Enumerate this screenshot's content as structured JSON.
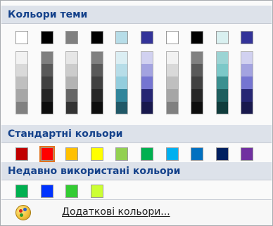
{
  "theme_colors": {
    "header": "Кольори теми",
    "columns": [
      {
        "name": "white",
        "shades": [
          "#ffffff",
          "#f2f2f2",
          "#d9d9d9",
          "#bfbfbf",
          "#a6a6a6",
          "#808080"
        ]
      },
      {
        "name": "black",
        "shades": [
          "#000000",
          "#7f7f7f",
          "#595959",
          "#404040",
          "#262626",
          "#0d0d0d"
        ]
      },
      {
        "name": "gray",
        "shades": [
          "#808080",
          "#e6e6e6",
          "#cccccc",
          "#b3b3b3",
          "#666666",
          "#333333"
        ]
      },
      {
        "name": "black-2",
        "shades": [
          "#000000",
          "#808080",
          "#595959",
          "#404040",
          "#262626",
          "#0d0d0d"
        ]
      },
      {
        "name": "light-cyan",
        "shades": [
          "#b7dde8",
          "#dbeef3",
          "#b7dde8",
          "#93cddd",
          "#31859b",
          "#205867"
        ]
      },
      {
        "name": "indigo",
        "shades": [
          "#333399",
          "#d1d1f0",
          "#a3a3e0",
          "#7575d1",
          "#262673",
          "#19194d"
        ]
      },
      {
        "name": "white-2",
        "shades": [
          "#ffffff",
          "#f2f2f2",
          "#d9d9d9",
          "#bfbfbf",
          "#a6a6a6",
          "#808080"
        ]
      },
      {
        "name": "black-3",
        "shades": [
          "#000000",
          "#808080",
          "#595959",
          "#404040",
          "#262626",
          "#0d0d0d"
        ]
      },
      {
        "name": "pale-cyan",
        "shades": [
          "#d9f0f0",
          "#9cd4d4",
          "#7cc8c8",
          "#3a8f8f",
          "#1e5e5e",
          "#103c3c"
        ]
      },
      {
        "name": "indigo-2",
        "shades": [
          "#333399",
          "#d1d1f0",
          "#a3a3e0",
          "#7575d1",
          "#262673",
          "#19194d"
        ]
      }
    ]
  },
  "standard_colors": {
    "header": "Стандартні кольори",
    "swatches": [
      {
        "name": "dark-red",
        "color": "#c00000"
      },
      {
        "name": "red",
        "color": "#ff0000",
        "selected": true
      },
      {
        "name": "orange",
        "color": "#ffc000"
      },
      {
        "name": "yellow",
        "color": "#ffff00"
      },
      {
        "name": "light-green",
        "color": "#92d050"
      },
      {
        "name": "green",
        "color": "#00b050"
      },
      {
        "name": "light-blue",
        "color": "#00b0f0"
      },
      {
        "name": "blue",
        "color": "#0070c0"
      },
      {
        "name": "dark-blue",
        "color": "#002060"
      },
      {
        "name": "purple",
        "color": "#7030a0"
      }
    ]
  },
  "recent_colors": {
    "header": "Недавно використані кольори",
    "swatches": [
      {
        "name": "green",
        "color": "#00b050"
      },
      {
        "name": "blue",
        "color": "#0033ff"
      },
      {
        "name": "bright-green",
        "color": "#33cc33"
      },
      {
        "name": "lime",
        "color": "#ccff33"
      }
    ]
  },
  "more_colors": {
    "label": "Додаткові кольори...",
    "icon": "palette-icon"
  },
  "colors": {
    "header_bg": "#dde2ea",
    "header_text": "#15428b",
    "selection": "#e2731e"
  }
}
